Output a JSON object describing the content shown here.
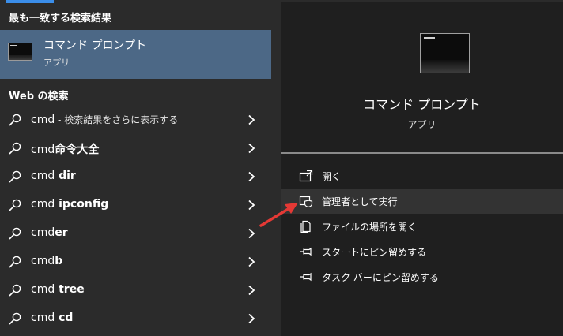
{
  "left_pane": {
    "best_match_header": "最も一致する検索結果",
    "best_match": {
      "title": "コマンド プロンプト",
      "subtitle": "アプリ",
      "icon": "command-prompt-icon"
    },
    "web_header": "Web の検索",
    "suggestions": [
      {
        "query": "cmd",
        "suffix": " - 検索結果をさらに表示する"
      },
      {
        "query": "cmd",
        "suffix": "命令大全"
      },
      {
        "query": "cmd",
        "suffix": " dir"
      },
      {
        "query": "cmd",
        "suffix": " ipconfig"
      },
      {
        "query": "cmd",
        "suffix": "er"
      },
      {
        "query": "cmd",
        "suffix": "b"
      },
      {
        "query": "cmd",
        "suffix": " tree"
      },
      {
        "query": "cmd",
        "suffix": " cd"
      }
    ]
  },
  "right_pane": {
    "app_title": "コマンド プロンプト",
    "app_subtitle": "アプリ",
    "actions": [
      {
        "label": "開く",
        "icon": "open-icon"
      },
      {
        "label": "管理者として実行",
        "icon": "run-as-admin-icon"
      },
      {
        "label": "ファイルの場所を開く",
        "icon": "file-location-icon"
      },
      {
        "label": "スタートにピン留めする",
        "icon": "pin-icon"
      },
      {
        "label": "タスク バーにピン留めする",
        "icon": "pin-icon"
      }
    ]
  },
  "colors": {
    "left_bg": "#2b2b2b",
    "right_bg": "#1f1f1f",
    "best_match_highlight": "#4c6886",
    "accent": "#3b8eea",
    "annotation_arrow": "#e53935"
  }
}
